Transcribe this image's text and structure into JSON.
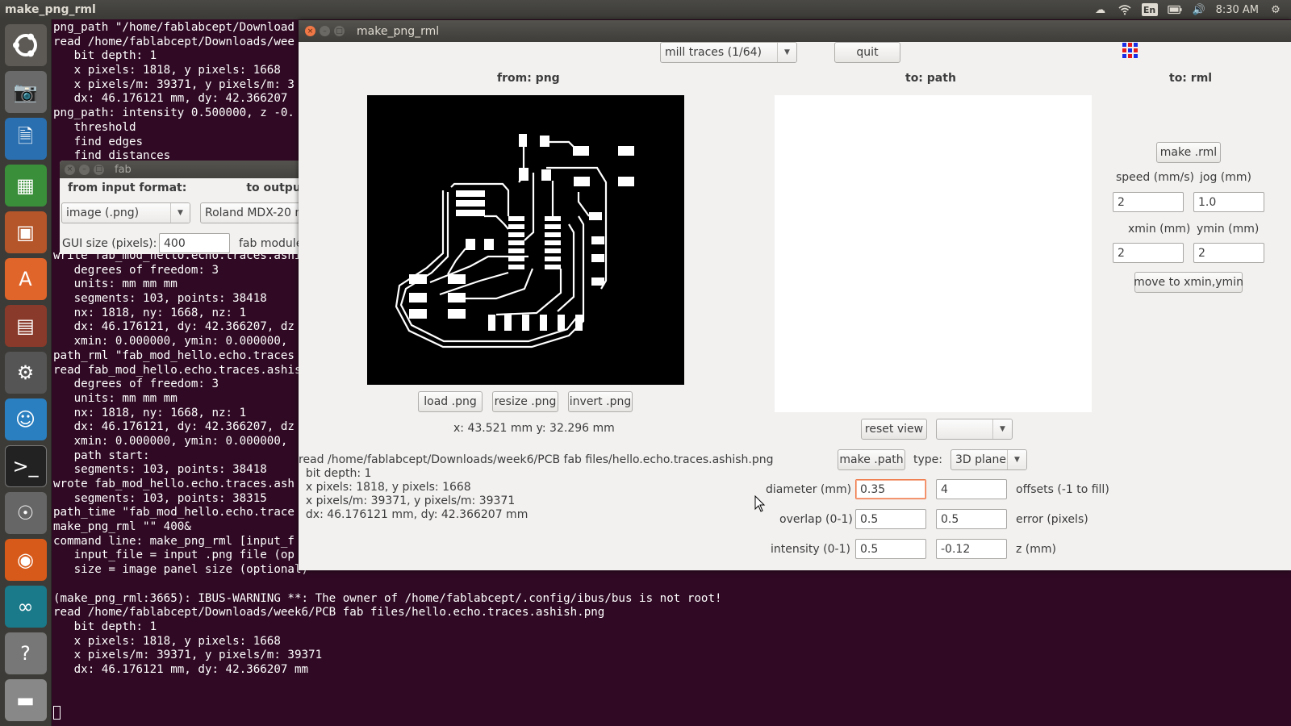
{
  "topbar": {
    "app_title": "make_png_rml",
    "clock": "8:30 AM",
    "keyboard": "En",
    "icons": [
      "dropbox-icon",
      "wifi-icon",
      "keyboard-icon",
      "battery-icon",
      "volume-icon",
      "gear-icon"
    ]
  },
  "launcher": {
    "items": [
      "ubuntu-dash-icon",
      "camera-icon",
      "writer-icon",
      "calc-icon",
      "impress-icon",
      "software-center-icon",
      "files-icon",
      "settings-icon",
      "empathy-icon",
      "terminal-icon",
      "gimp-icon",
      "firefox-icon",
      "arduino-icon",
      "help-icon",
      "drive-icon"
    ]
  },
  "terminal": {
    "lines": [
      "png_path \"/home/fablabcept/Download",
      "read /home/fablabcept/Downloads/wee",
      "   bit depth: 1",
      "   x pixels: 1818, y pixels: 1668",
      "   x pixels/m: 39371, y pixels/m: 3",
      "   dx: 46.176121 mm, dy: 42.366207",
      "png_path: intensity 0.500000, z -0.",
      "   threshold",
      "   find edges",
      "   find distances",
      "",
      "",
      "",
      "",
      "",
      "",
      "write fab_mod_hello.echo.traces.ashi",
      "   degrees of freedom: 3",
      "   units: mm mm mm",
      "   segments: 103, points: 38418",
      "   nx: 1818, ny: 1668, nz: 1",
      "   dx: 46.176121, dy: 42.366207, dz",
      "   xmin: 0.000000, ymin: 0.000000,",
      "path_rml \"fab_mod_hello.echo.traces",
      "read fab_mod_hello.echo.traces.ashis",
      "   degrees of freedom: 3",
      "   units: mm mm mm",
      "   nx: 1818, ny: 1668, nz: 1",
      "   dx: 46.176121, dy: 42.366207, dz",
      "   xmin: 0.000000, ymin: 0.000000,",
      "   path start:",
      "   segments: 103, points: 38418",
      "wrote fab_mod_hello.echo.traces.ash",
      "   segments: 103, points: 38315",
      "path_time \"fab_mod_hello.echo.trace",
      "make_png_rml \"\" 400&",
      "command line: make_png_rml [input_f",
      "   input_file = input .png file (op",
      "   size = image panel size (optional)",
      "",
      "(make_png_rml:3665): IBUS-WARNING **: The owner of /home/fablabcept/.config/ibus/bus is not root!",
      "read /home/fablabcept/Downloads/week6/PCB fab files/hello.echo.traces.ashish.png",
      "   bit depth: 1",
      "   x pixels: 1818, y pixels: 1668",
      "   x pixels/m: 39371, y pixels/m: 39371",
      "   dx: 46.176121 mm, dy: 42.366207 mm",
      "",
      ""
    ]
  },
  "fab_window": {
    "title": "fab",
    "from_label": "from input format:",
    "to_label": "to output",
    "input_format": "image (.png)",
    "output_format": "Roland MDX-20 mi",
    "gui_size_label": "GUI size (pixels):",
    "gui_size_value": "400",
    "fab_module_label": "fab module"
  },
  "main_window": {
    "title": "make_png_rml",
    "process_select": "mill traces (1/64)",
    "quit_label": "quit",
    "from_png": "from: png",
    "to_path": "to: path",
    "to_rml": "to: rml",
    "load_png": "load .png",
    "resize_png": "resize .png",
    "invert_png": "invert .png",
    "coords": "x: 43.521 mm  y: 32.296 mm",
    "info_lines": [
      "read /home/fablabcept/Downloads/week6/PCB fab files/hello.echo.traces.ashish.png",
      "  bit depth: 1",
      "  x pixels: 1818, y pixels: 1668",
      "  x pixels/m: 39371, y pixels/m: 39371",
      "  dx: 46.176121 mm, dy: 42.366207 mm"
    ],
    "reset_view": "reset view",
    "view_select": "",
    "make_path": "make .path",
    "type_label": "type:",
    "type_value": "3D plane",
    "diameter_label": "diameter (mm)",
    "diameter_value": "0.35",
    "offsets_value": "4",
    "offsets_label": "offsets (-1 to fill)",
    "overlap_label": "overlap (0-1)",
    "overlap_value": "0.5",
    "error_value": "0.5",
    "error_label": "error (pixels)",
    "intensity_label": "intensity (0-1)",
    "intensity_value": "0.5",
    "z_value": "-0.12",
    "z_label": "z (mm)",
    "make_rml": "make .rml",
    "speed_label": "speed (mm/s)",
    "jog_label": "jog (mm)",
    "speed_value": "2",
    "jog_value": "1.0",
    "xmin_label": "xmin (mm)",
    "ymin_label": "ymin (mm)",
    "xmin_value": "2",
    "ymin_value": "2",
    "move_label": "move to xmin,ymin"
  },
  "colors": {
    "terminal_bg": "#300a24",
    "launcher_bg": "#3c3b37",
    "window_bg": "#f2f1f0",
    "close_button": "#f07746",
    "focus_border": "#f07746"
  }
}
